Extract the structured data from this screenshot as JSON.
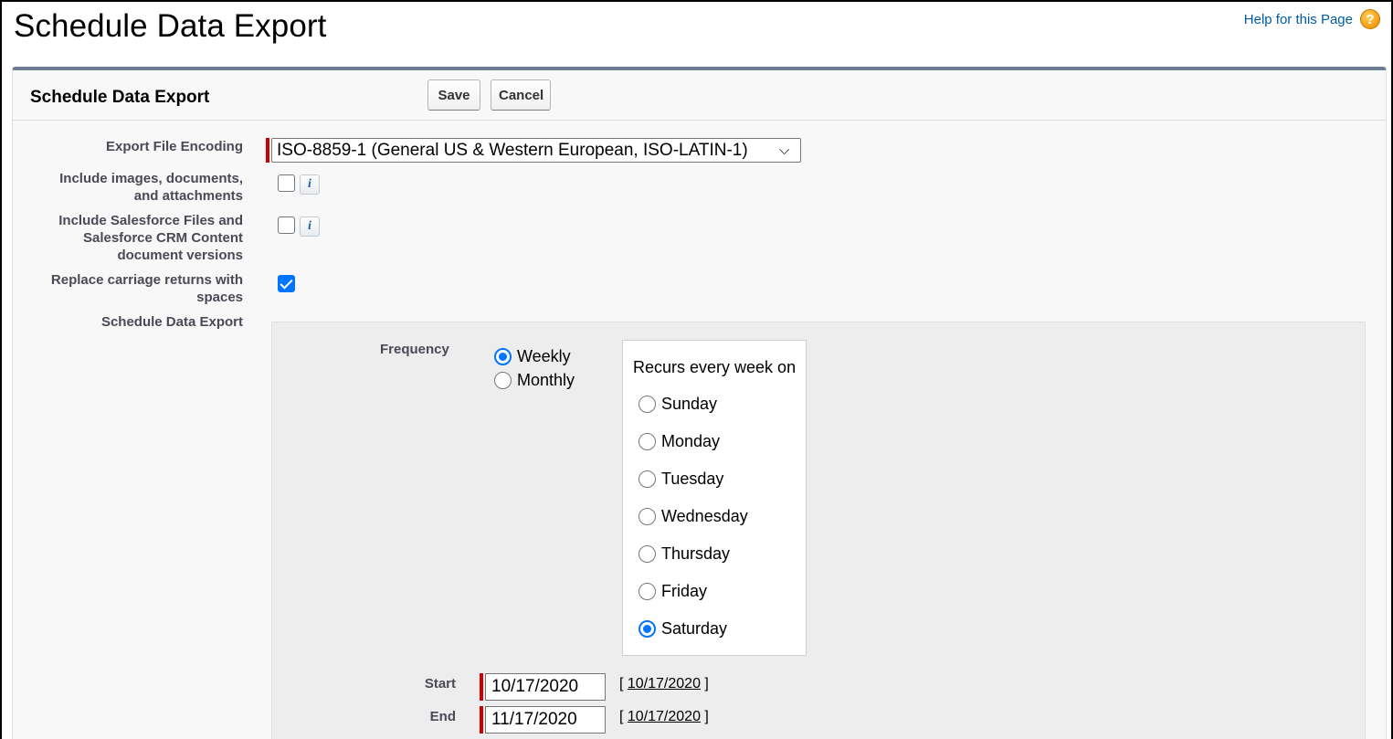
{
  "header": {
    "page_title": "Schedule Data Export",
    "help_link": "Help for this Page",
    "help_icon": "?"
  },
  "panel": {
    "title": "Schedule Data Export",
    "save_label": "Save",
    "cancel_label": "Cancel"
  },
  "fields": {
    "encoding_label": "Export File Encoding",
    "encoding_value": "ISO-8859-1 (General US & Western European, ISO-LATIN-1)",
    "include_images_label_1": "Include images, documents,",
    "include_images_label_2": "and attachments",
    "include_images_checked": false,
    "include_files_label_1": "Include Salesforce Files and",
    "include_files_label_2": "Salesforce CRM Content",
    "include_files_label_3": "document versions",
    "include_files_checked": false,
    "replace_cr_label_1": "Replace carriage returns with",
    "replace_cr_label_2": "spaces",
    "replace_cr_checked": true,
    "schedule_label": "Schedule Data Export",
    "info_glyph": "i"
  },
  "schedule": {
    "frequency_label": "Frequency",
    "frequency_options": [
      "Weekly",
      "Monthly"
    ],
    "frequency_selected": "Weekly",
    "recurs_title": "Recurs every week on",
    "days": [
      "Sunday",
      "Monday",
      "Tuesday",
      "Wednesday",
      "Thursday",
      "Friday",
      "Saturday"
    ],
    "day_selected": "Saturday",
    "start_label": "Start",
    "start_value": "10/17/2020",
    "start_today": "10/17/2020",
    "end_label": "End",
    "end_value": "11/17/2020",
    "end_today": "10/17/2020"
  },
  "colors": {
    "link": "#015ba7",
    "required": "#cc0000",
    "checkbox_accent": "#0075ff",
    "panel_border": "#6c7d94"
  }
}
